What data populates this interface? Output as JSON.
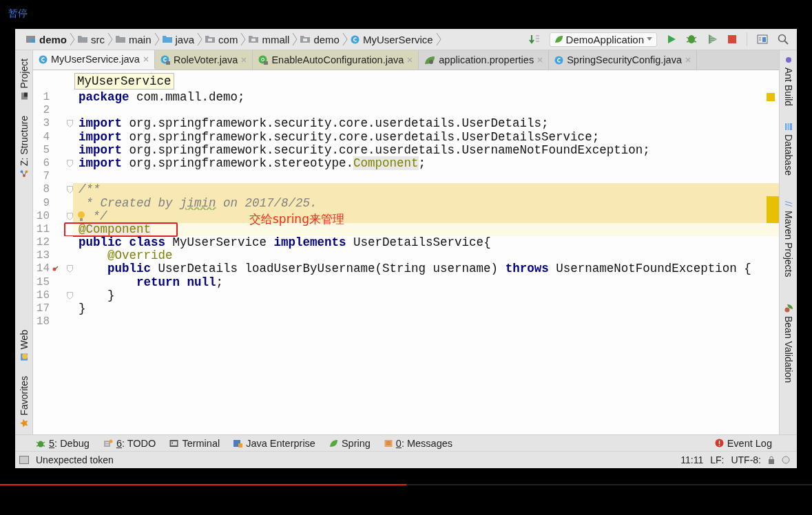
{
  "player": {
    "status": "暂停",
    "progress": {
      "level": 0.5
    }
  },
  "breadcrumbs": [
    {
      "label": "demo",
      "kind": "module"
    },
    {
      "label": "src",
      "kind": "folder"
    },
    {
      "label": "main",
      "kind": "folder"
    },
    {
      "label": "java",
      "kind": "source"
    },
    {
      "label": "com",
      "kind": "package"
    },
    {
      "label": "mmall",
      "kind": "package"
    },
    {
      "label": "demo",
      "kind": "package"
    },
    {
      "label": "MyUserService",
      "kind": "class"
    }
  ],
  "run_config": {
    "label": "DemoApplication"
  },
  "tabs": [
    {
      "label": "MyUserService.java",
      "kind": "class",
      "selected": true
    },
    {
      "label": "RoleVoter.java",
      "kind": "library-class",
      "selected": false
    },
    {
      "label": "EnableAutoConfiguration.java",
      "kind": "library-annotation",
      "selected": false
    },
    {
      "label": "application.properties",
      "kind": "properties",
      "selected": false
    },
    {
      "label": "SpringSecurityConfig.java",
      "kind": "class",
      "selected": false
    }
  ],
  "left_tools": [
    {
      "label": "Project",
      "kind": "project"
    },
    {
      "label": "Z: Structure",
      "kind": "structure"
    },
    {
      "label": "Web",
      "kind": "web"
    },
    {
      "label": "Favorites",
      "kind": "favorites"
    }
  ],
  "right_tools": [
    {
      "label": "Ant Build",
      "kind": "ant"
    },
    {
      "label": "Database",
      "kind": "database"
    },
    {
      "label": "Maven Projects",
      "kind": "maven"
    },
    {
      "label": "Bean Validation",
      "kind": "bean"
    }
  ],
  "editor": {
    "breadcrumb_tooltip": "MyUserService",
    "lines": [
      {
        "number": "1",
        "tokens": [
          {
            "kind": "kw",
            "text": "package"
          },
          {
            "kind": "plain",
            "text": " com.mmall.demo;"
          }
        ]
      },
      {
        "number": "2"
      },
      {
        "number": "3",
        "fold": true,
        "tokens": [
          {
            "kind": "kw",
            "text": "import"
          },
          {
            "kind": "plain",
            "text": " org.springframework.security.core.userdetails.UserDetails;"
          }
        ]
      },
      {
        "number": "4",
        "tokens": [
          {
            "kind": "kw",
            "text": "import"
          },
          {
            "kind": "plain",
            "text": " org.springframework.security.core.userdetails.UserDetailsService;"
          }
        ]
      },
      {
        "number": "5",
        "tokens": [
          {
            "kind": "kw",
            "text": "import"
          },
          {
            "kind": "plain",
            "text": " org.springframework.security.core.userdetails.UsernameNotFoundException;"
          }
        ]
      },
      {
        "number": "6",
        "fold": true,
        "tokens": [
          {
            "kind": "kw",
            "text": "import"
          },
          {
            "kind": "plain",
            "text": " org.springframework.stereotype."
          },
          {
            "kind": "ref",
            "text": "Component"
          },
          {
            "kind": "plain",
            "text": ";"
          }
        ]
      },
      {
        "number": "7"
      },
      {
        "number": "8",
        "fold": true,
        "selected": true,
        "tokens": [
          {
            "kind": "comment",
            "text": "/**"
          }
        ]
      },
      {
        "number": "9",
        "selected": true,
        "tokens": [
          {
            "kind": "comment",
            "text": " * Created by "
          },
          {
            "kind": "comment-typo",
            "text": "jimin"
          },
          {
            "kind": "comment",
            "text": " on 2017/8/25."
          }
        ]
      },
      {
        "number": "10",
        "fold": true,
        "bulb": true,
        "selected": true,
        "tokens": [
          {
            "kind": "comment",
            "text": " */"
          }
        ]
      },
      {
        "number": "11",
        "current": true,
        "callout": "交给spring来管理",
        "tokens": [
          {
            "kind": "annot-ref",
            "text": "@Component"
          }
        ]
      },
      {
        "number": "12",
        "tokens": [
          {
            "kind": "kw",
            "text": "public class"
          },
          {
            "kind": "plain",
            "text": " MyUserService "
          },
          {
            "kind": "kw",
            "text": "implements"
          },
          {
            "kind": "plain",
            "text": " UserDetailsService{"
          }
        ]
      },
      {
        "number": "13",
        "tokens": [
          {
            "kind": "annot",
            "text": "    @Override"
          }
        ]
      },
      {
        "number": "14",
        "fold": true,
        "override": true,
        "tokens": [
          {
            "kind": "kw",
            "text": "    public"
          },
          {
            "kind": "plain",
            "text": " UserDetails loadUserByUsername(String username) "
          },
          {
            "kind": "kw",
            "text": "throws"
          },
          {
            "kind": "plain",
            "text": " UsernameNotFoundException {"
          }
        ]
      },
      {
        "number": "15",
        "tokens": [
          {
            "kind": "kw",
            "text": "        return null"
          },
          {
            "kind": "plain",
            "text": ";"
          }
        ]
      },
      {
        "number": "16",
        "fold": true,
        "tokens": [
          {
            "kind": "plain",
            "text": "    }"
          }
        ]
      },
      {
        "number": "17",
        "tokens": [
          {
            "kind": "plain",
            "text": "}"
          }
        ]
      },
      {
        "number": "18"
      }
    ]
  },
  "bottom_tools": [
    {
      "mnemonic": "5",
      "label": ": Debug",
      "kind": "debug"
    },
    {
      "mnemonic": "6",
      "label": ": TODO",
      "kind": "todo"
    },
    {
      "label": "Terminal",
      "kind": "terminal"
    },
    {
      "label": "Java Enterprise",
      "kind": "javaee"
    },
    {
      "label": "Spring",
      "kind": "spring"
    },
    {
      "mnemonic": "0",
      "label": ": Messages",
      "kind": "messages"
    },
    {
      "label": "Event Log",
      "kind": "eventlog"
    }
  ],
  "status_bar": {
    "message": "Unexpected token",
    "position": "11:11",
    "line_separator": "LF:",
    "encoding": "UTF-8:"
  }
}
